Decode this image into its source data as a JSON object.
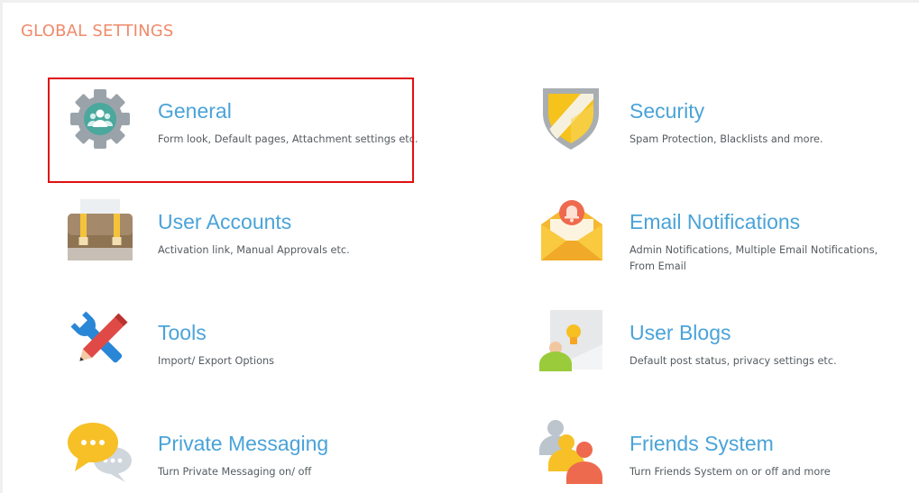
{
  "page": {
    "title": "GLOBAL SETTINGS"
  },
  "items": [
    {
      "id": "general",
      "icon": "gear-icon",
      "title": "General",
      "desc": "Form look, Default pages, Attachment settings etc."
    },
    {
      "id": "security",
      "icon": "shield-icon",
      "title": "Security",
      "desc": "Spam Protection, Blacklists and more."
    },
    {
      "id": "user-accounts",
      "icon": "briefcase-icon",
      "title": "User Accounts",
      "desc": "Activation link, Manual Approvals etc."
    },
    {
      "id": "email-notifications",
      "icon": "envelope-bell-icon",
      "title": "Email Notifications",
      "desc": "Admin Notifications, Multiple Email Notifications, From Email"
    },
    {
      "id": "tools",
      "icon": "tools-icon",
      "title": "Tools",
      "desc": "Import/ Export Options"
    },
    {
      "id": "user-blogs",
      "icon": "blog-user-icon",
      "title": "User Blogs",
      "desc": "Default post status, privacy settings etc."
    },
    {
      "id": "private-messaging",
      "icon": "chat-bubbles-icon",
      "title": "Private Messaging",
      "desc": "Turn Private Messaging on/ off"
    },
    {
      "id": "friends-system",
      "icon": "friends-icon",
      "title": "Friends System",
      "desc": "Turn Friends System on or off and more"
    }
  ],
  "colors": {
    "title": "#f08a6a",
    "item_title": "#4aa3d8",
    "highlight": "#e01010"
  }
}
